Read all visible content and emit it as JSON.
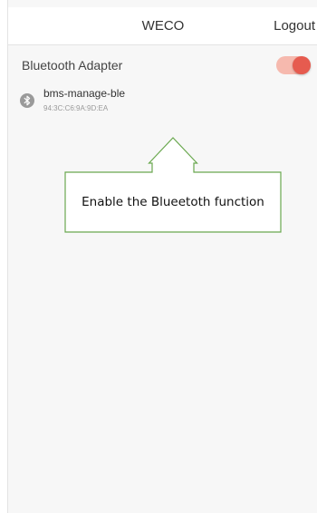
{
  "header": {
    "title": "WECO",
    "logout_label": "Logout"
  },
  "adapter": {
    "label": "Bluetooth Adapter",
    "enabled": true
  },
  "devices": [
    {
      "name": "bms-manage-ble",
      "mac": "94:3C:C6:9A:9D:EA",
      "icon": "bluetooth-icon"
    }
  ],
  "callout": {
    "text": "Enable the Blueetoth function"
  },
  "colors": {
    "toggle_knob": "#e65b4f",
    "toggle_track": "#f6b9ae",
    "callout_border": "#6aa84f",
    "background": "#f7f7f7",
    "header_bg": "#ffffff"
  }
}
